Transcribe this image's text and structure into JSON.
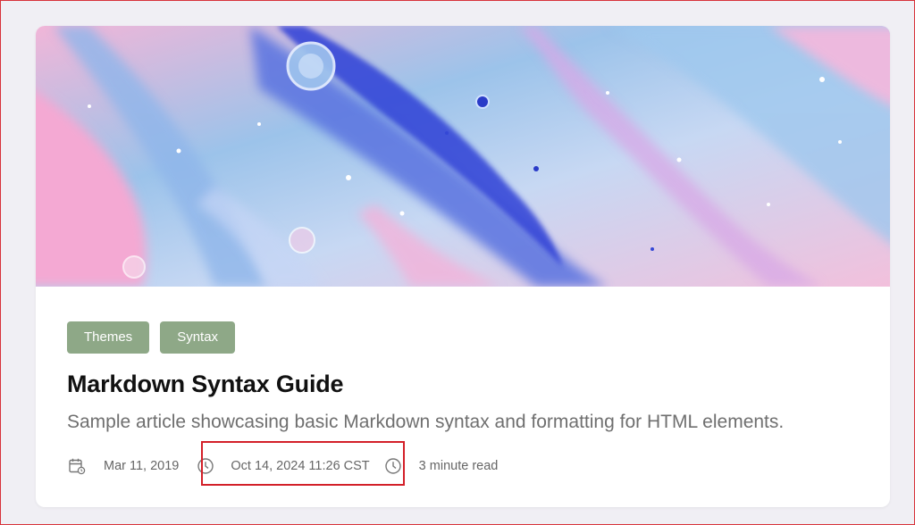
{
  "post": {
    "tags": [
      {
        "label": "Themes"
      },
      {
        "label": "Syntax"
      }
    ],
    "title": "Markdown Syntax Guide",
    "description": "Sample article showcasing basic Markdown syntax and formatting for HTML elements.",
    "meta": {
      "published_icon": "calendar-icon",
      "published": "Mar 11, 2019",
      "updated_icon": "clock-icon",
      "updated": "Oct 14, 2024 11:26 CST",
      "reading_icon": "clock-icon",
      "reading_time": "3 minute read"
    },
    "hero_icon": "abstract-fluid-art-image"
  },
  "colors": {
    "tag_bg": "#8ea887",
    "highlight_border": "#d32029",
    "page_bg": "#f0eff4"
  }
}
